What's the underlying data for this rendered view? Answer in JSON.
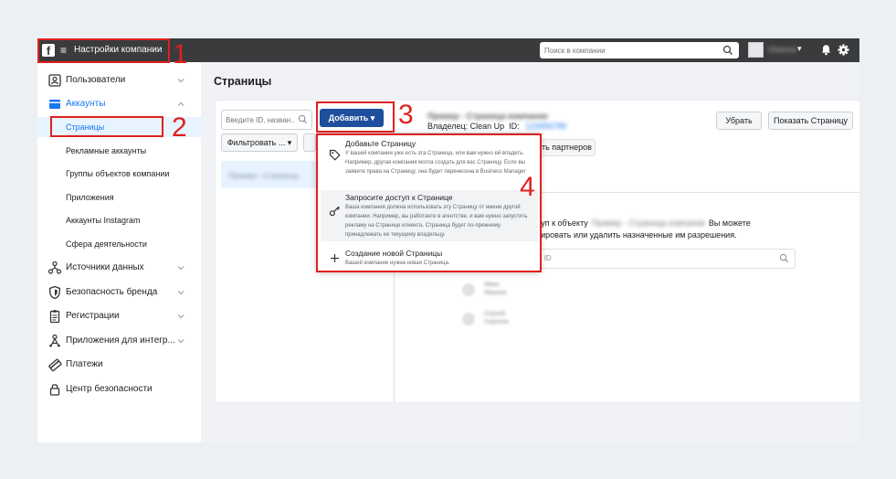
{
  "header": {
    "app_title": "Настройки компании",
    "search_placeholder": "Поиск в компании",
    "account_name": "Иванов"
  },
  "sidebar": {
    "items": [
      {
        "label": "Пользователи"
      },
      {
        "label": "Аккаунты"
      },
      {
        "label": "Источники данных"
      },
      {
        "label": "Безопасность бренда"
      },
      {
        "label": "Регистрации"
      },
      {
        "label": "Приложения для интегр..."
      },
      {
        "label": "Платежи"
      },
      {
        "label": "Центр безопасности"
      }
    ],
    "accounts_sub": [
      {
        "label": "Страницы"
      },
      {
        "label": "Рекламные аккаунты"
      },
      {
        "label": "Группы объектов компании"
      },
      {
        "label": "Приложения"
      },
      {
        "label": "Аккаунты Instagram"
      },
      {
        "label": "Сфера деятельности"
      }
    ]
  },
  "main": {
    "page_title": "Страницы",
    "filter_placeholder": "Введите ID, назван...",
    "filter_button": "Фильтровать ...",
    "add_button": "Добавить",
    "list_item": "Пример - Страница",
    "detail": {
      "blurred_title": "Пример - Страница компании",
      "owner_label": "Владелец: Clean Up",
      "id_label": "ID:",
      "id_value": "123456789",
      "remove_button": "Убрать",
      "show_page_button": "Показать Страницу",
      "partners_fragment": "ть партнеров",
      "access_line1_start": "туп к объекту",
      "access_line1_name": "Пример - Страница компании",
      "access_line1_end": "Вы можете",
      "access_line2": "тировать или удалить назначенные им разрешения.",
      "search_fragment": "и ID",
      "people": [
        {
          "line1": "Иван",
          "line2": "Иванов"
        },
        {
          "line1": "Сергей",
          "line2": "Сергеев"
        }
      ]
    },
    "dropdown": {
      "items": [
        {
          "title": "Добавьте Страницу",
          "desc": "У вашей компании уже есть эта Страница, или вам нужно ей владеть. Например, другая компания могла создать для вас Страницу. Если вы заявите права на Страницу, она будет перенесена в Business Manager"
        },
        {
          "title": "Запросите доступ к Странице",
          "desc": "Ваша компания должна использовать эту Страницу от имени другой компании. Например, вы работаете в агентстве, и вам нужно запустить рекламу на Странице клиента. Страница будет по-прежнему принадлежать ее текущему владельцу."
        },
        {
          "title": "Создание новой Страницы",
          "desc": "Вашей компании нужна новая Страница."
        }
      ]
    }
  },
  "annotations": {
    "n1": "1",
    "n2": "2",
    "n3": "3",
    "n4": "4"
  },
  "colors": {
    "accent": "#1e4f9c",
    "annotation": "#e02020",
    "topbar": "#3a3b3c"
  }
}
